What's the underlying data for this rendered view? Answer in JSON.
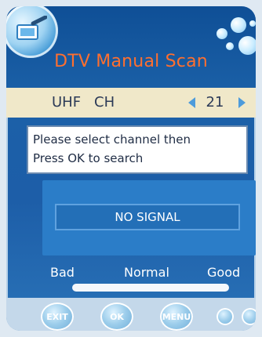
{
  "title": "DTV Manual Scan",
  "channel": {
    "band": "UHF",
    "ch_label": "CH",
    "number": "21"
  },
  "message": {
    "line1": "Please select channel then",
    "line2": "Press OK to search"
  },
  "signal": {
    "status": "NO SIGNAL"
  },
  "quality": {
    "bad": "Bad",
    "normal": "Normal",
    "good": "Good"
  },
  "buttons": {
    "exit": "EXIT",
    "ok": "OK",
    "menu": "MENU"
  },
  "colors": {
    "title": "#ff6f2f",
    "background": "#1a62a8",
    "channel_bar": "#f0e8c9",
    "arrows": "#4d9bdb"
  },
  "icons": {
    "logo": "tv-remote-icon",
    "decor": "bubbles-icon",
    "left": "arrow-left-icon",
    "right": "arrow-right-icon"
  }
}
